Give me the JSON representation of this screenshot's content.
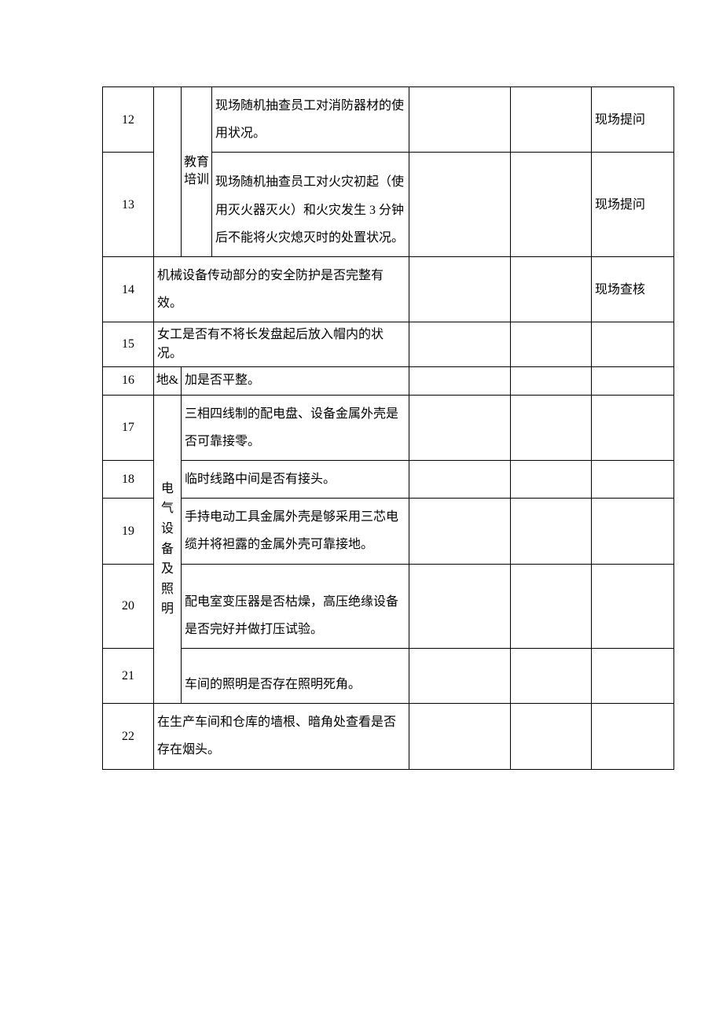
{
  "rows": {
    "r12": {
      "num": "12",
      "cat2": "教育培训",
      "desc": "现场随机抽查员工对消防器材的使用状况。",
      "remark": "现场提问"
    },
    "r13": {
      "num": "13",
      "desc": "现场随机抽查员工对火灾初起（使用灭火器灭火）和火灾发生 3 分钟后不能将火灾熄灭时的处置状况。",
      "remark": "现场提问"
    },
    "r14": {
      "num": "14",
      "desc": "机械设备传动部分的安全防护是否完整有效。",
      "remark": "现场查核"
    },
    "r15": {
      "num": "15",
      "desc": "女工是否有不将长发盘起后放入帽内的状况。",
      "remark": ""
    },
    "r16": {
      "num": "16",
      "cat1": "地&",
      "desc": "加是否平整。",
      "remark": ""
    },
    "r17": {
      "num": "17",
      "cat1": "电气设备及照明",
      "desc": "三相四线制的配电盘、设备金属外壳是否可靠接零。",
      "remark": ""
    },
    "r18": {
      "num": "18",
      "desc": "临时线路中间是否有接头。",
      "remark": ""
    },
    "r19": {
      "num": "19",
      "desc": "手持电动工具金属外壳是够采用三芯电缆并将袒露的金属外壳可靠接地。",
      "remark": ""
    },
    "r20": {
      "num": "20",
      "desc": "配电室变压器是否枯燥，高压绝缘设备是否完好并做打压试验。",
      "remark": ""
    },
    "r21": {
      "num": "21",
      "desc": "车间的照明是否存在照明死角。",
      "remark": ""
    },
    "r22": {
      "num": "22",
      "desc": "在生产车间和仓库的墙根、暗角处查看是否存在烟头。",
      "remark": ""
    }
  }
}
